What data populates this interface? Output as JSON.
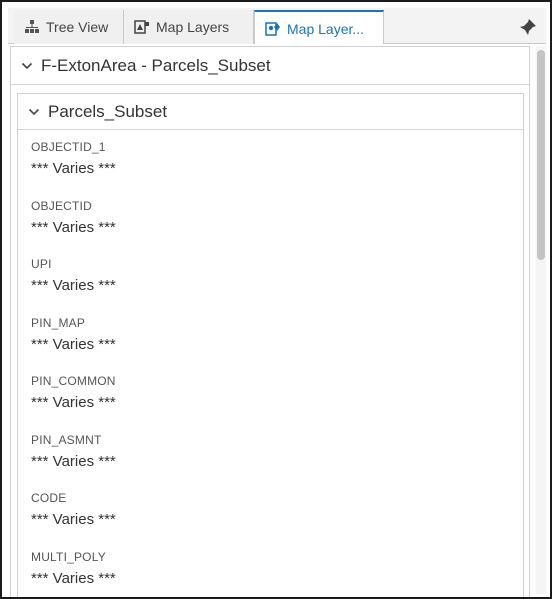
{
  "tabs": [
    {
      "label": "Tree View",
      "icon": "tree-view-icon",
      "active": false
    },
    {
      "label": "Map Layers",
      "icon": "map-layers-icon",
      "active": false
    },
    {
      "label": "Map Layer...",
      "icon": "map-layer-details-icon",
      "active": true
    }
  ],
  "layer": {
    "title": "F-ExtonArea - Parcels_Subset"
  },
  "sublayer": {
    "title": "Parcels_Subset"
  },
  "fields": [
    {
      "name": "OBJECTID_1",
      "value": "*** Varies ***"
    },
    {
      "name": "OBJECTID",
      "value": "*** Varies ***"
    },
    {
      "name": "UPI",
      "value": "*** Varies ***"
    },
    {
      "name": "PIN_MAP",
      "value": "*** Varies ***"
    },
    {
      "name": "PIN_COMMON",
      "value": "*** Varies ***"
    },
    {
      "name": "PIN_ASMNT",
      "value": "*** Varies ***"
    },
    {
      "name": "CODE",
      "value": "*** Varies ***"
    },
    {
      "name": "MULTI_POLY",
      "value": "*** Varies ***"
    }
  ],
  "colors": {
    "accent": "#1a73b8",
    "border": "#cfcfcf"
  }
}
